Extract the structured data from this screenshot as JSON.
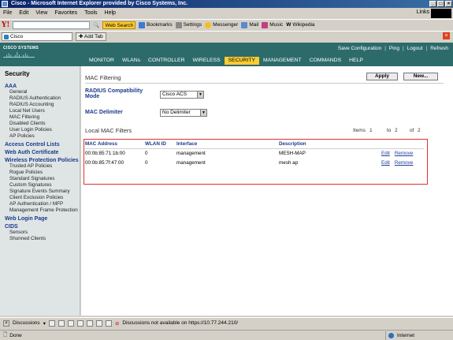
{
  "window": {
    "title": "Cisco - Microsoft Internet Explorer provided by Cisco Systems, Inc."
  },
  "menu": [
    "File",
    "Edit",
    "View",
    "Favorites",
    "Tools",
    "Help"
  ],
  "links_label": "Links",
  "toolbar": {
    "logo": "Y!",
    "web_search": "Web Search",
    "bookmarks": "Bookmarks",
    "settings": "Settings",
    "messenger": "Messenger",
    "mail": "Mail",
    "music": "Music",
    "wikipedia": "Wikipedia"
  },
  "tabs": {
    "current": "Cisco",
    "add": "Add Tab"
  },
  "cisco": {
    "logo": "CISCO SYSTEMS",
    "top_links": [
      "Save Configuration",
      "Ping",
      "Logout",
      "Refresh"
    ],
    "nav": [
      "MONITOR",
      "WLANs",
      "CONTROLLER",
      "WIRELESS",
      "SECURITY",
      "MANAGEMENT",
      "COMMANDS",
      "HELP"
    ],
    "active_nav": "SECURITY"
  },
  "sidebar": {
    "title": "Security",
    "groups": [
      {
        "heading": "AAA",
        "items": [
          "General",
          "RADIUS Authentication",
          "RADIUS Accounting",
          "Local Net Users",
          "MAC Filtering",
          "Disabled Clients",
          "User Login Policies",
          "AP Policies"
        ]
      },
      {
        "heading": "Access Control Lists",
        "items": []
      },
      {
        "heading": "Web Auth Certificate",
        "items": []
      },
      {
        "heading": "Wireless Protection Policies",
        "items": [
          "Trusted AP Policies",
          "Rogue Policies",
          "Standard Signatures",
          "Custom Signatures",
          "Signature Events Summary",
          "Client Exclusion Policies",
          "AP Authentication / MFP",
          "Management Frame Protection"
        ]
      },
      {
        "heading": "Web Login Page",
        "items": []
      },
      {
        "heading": "CIDS",
        "items": [
          "Sensors",
          "Shunned Clients"
        ]
      }
    ]
  },
  "page": {
    "title": "MAC Filtering",
    "apply": "Apply",
    "new": "New...",
    "radius_label": "RADIUS Compatibility Mode",
    "radius_value": "Cisco ACS",
    "delimiter_label": "MAC Delimiter",
    "delimiter_value": "No Delimiter",
    "section_title": "Local MAC Filters",
    "items_label": "Items",
    "items_from": "1",
    "items_to_label": "to",
    "items_to": "2",
    "items_of_label": "of",
    "items_total": "2",
    "columns": [
      "MAC Address",
      "WLAN ID",
      "Interface",
      "Description"
    ],
    "rows": [
      {
        "mac": "00:0b:85:71:1b:00",
        "wlan": "0",
        "iface": "management",
        "desc": "MESH-MAP",
        "edit": "Edit",
        "remove": "Remove"
      },
      {
        "mac": "00:0b:85:7f:47:00",
        "wlan": "0",
        "iface": "management",
        "desc": "mesh ap",
        "edit": "Edit",
        "remove": "Remove"
      }
    ]
  },
  "discussions": {
    "label": "Discussions",
    "message": "Discussions not available on https://10.77.244.210/"
  },
  "status": {
    "left": "Done",
    "zone": "Internet"
  }
}
